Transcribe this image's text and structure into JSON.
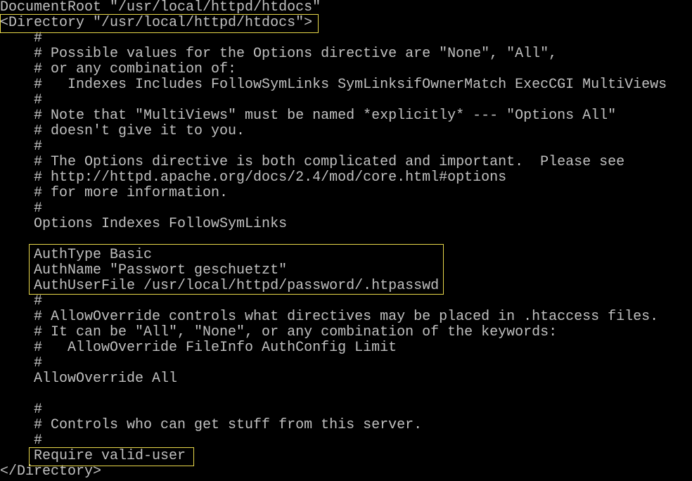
{
  "terminal": {
    "colors": {
      "background": "#000000",
      "text": "#c0c0c0",
      "highlight_border": "#e8d84a"
    },
    "lines": [
      "DocumentRoot \"/usr/local/httpd/htdocs\"",
      "<Directory \"/usr/local/httpd/htdocs\">",
      "    #",
      "    # Possible values for the Options directive are \"None\", \"All\",",
      "    # or any combination of:",
      "    #   Indexes Includes FollowSymLinks SymLinksifOwnerMatch ExecCGI MultiViews",
      "    #",
      "    # Note that \"MultiViews\" must be named *explicitly* --- \"Options All\"",
      "    # doesn't give it to you.",
      "    #",
      "    # The Options directive is both complicated and important.  Please see",
      "    # http://httpd.apache.org/docs/2.4/mod/core.html#options",
      "    # for more information.",
      "    #",
      "    Options Indexes FollowSymLinks",
      "",
      "    AuthType Basic",
      "    AuthName \"Passwort geschuetzt\"",
      "    AuthUserFile /usr/local/httpd/password/.htpasswd",
      "    #",
      "    # AllowOverride controls what directives may be placed in .htaccess files.",
      "    # It can be \"All\", \"None\", or any combination of the keywords:",
      "    #   AllowOverride FileInfo AuthConfig Limit",
      "    #",
      "    AllowOverride All",
      "",
      "    #",
      "    # Controls who can get stuff from this server.",
      "    #",
      "    Require valid-user",
      "</Directory>"
    ]
  }
}
